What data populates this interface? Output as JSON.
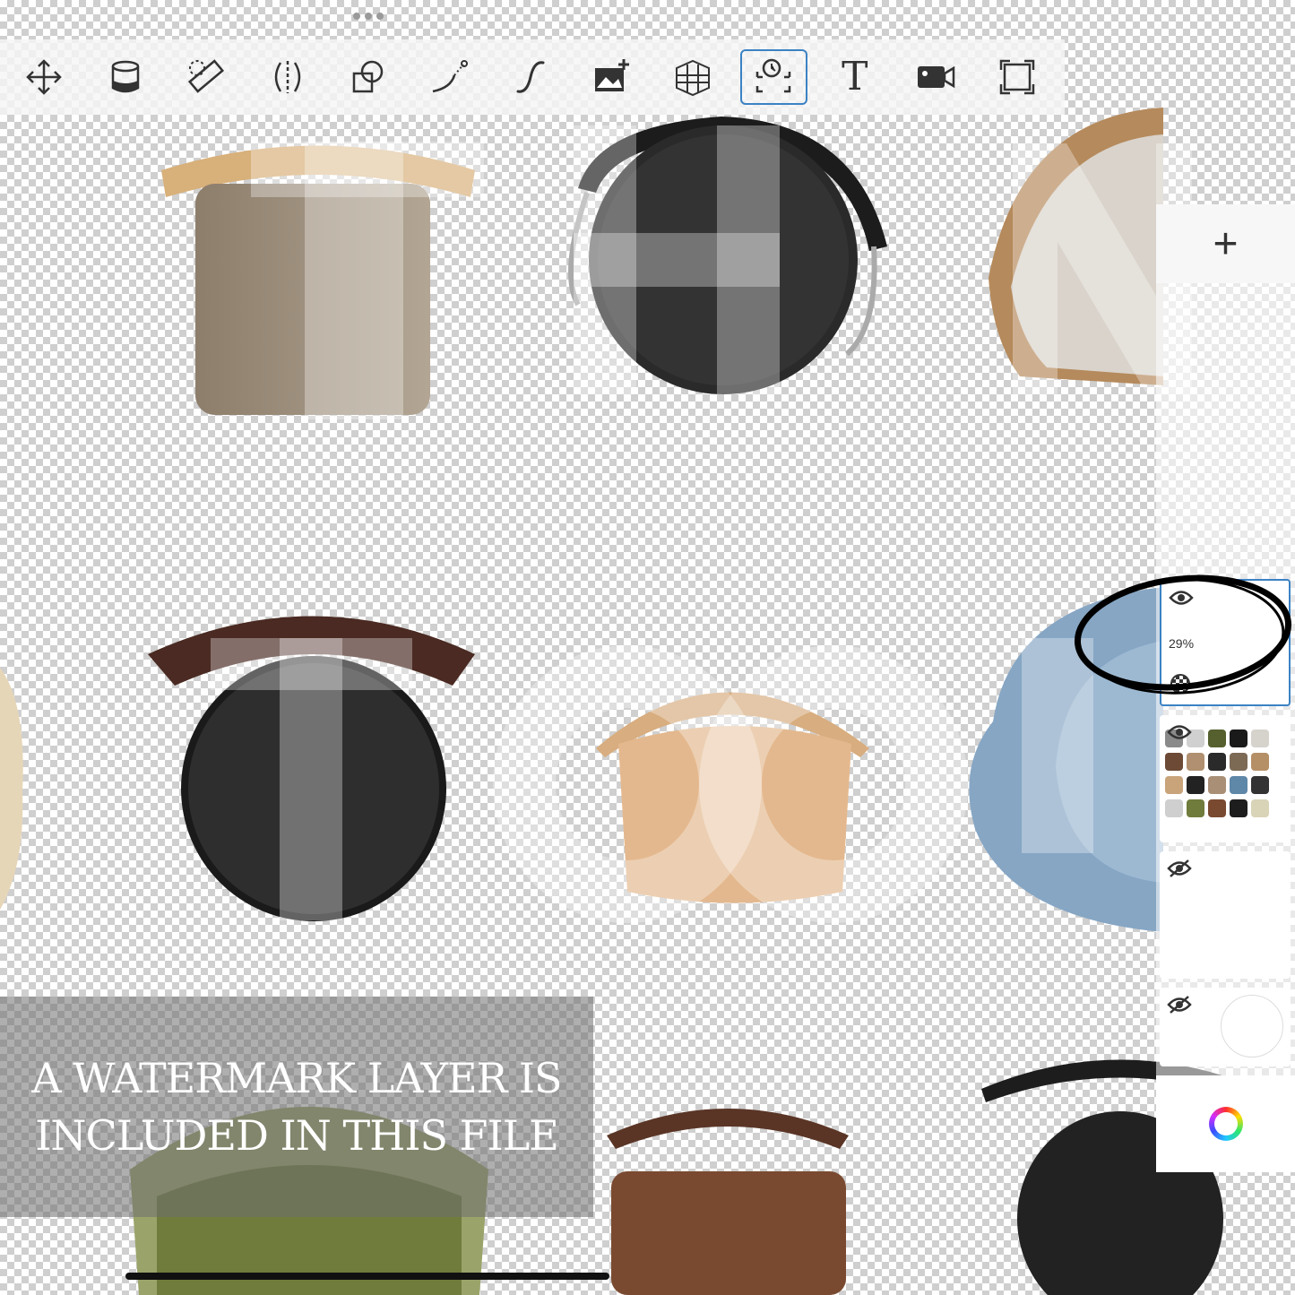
{
  "toolbar": {
    "tools": [
      {
        "name": "move-tool",
        "icon": "move-arrows-icon"
      },
      {
        "name": "fill-tool",
        "icon": "paint-bucket-icon"
      },
      {
        "name": "ruler-tool",
        "icon": "ruler-icon"
      },
      {
        "name": "symmetry-tool",
        "icon": "symmetry-icon"
      },
      {
        "name": "shape-tool",
        "icon": "shapes-icon"
      },
      {
        "name": "curve-tool",
        "icon": "curve-icon"
      },
      {
        "name": "stroke-tool",
        "icon": "stroke-icon"
      },
      {
        "name": "image-insert-tool",
        "icon": "image-add-icon"
      },
      {
        "name": "perspective-tool",
        "icon": "perspective-grid-icon"
      },
      {
        "name": "time-lapse-tool",
        "icon": "time-lapse-icon",
        "active": true
      },
      {
        "name": "text-tool",
        "icon": "text-icon",
        "glyph": "T"
      },
      {
        "name": "record-tool",
        "icon": "video-camera-icon"
      },
      {
        "name": "fullscreen-tool",
        "icon": "fullscreen-icon"
      }
    ]
  },
  "watermark_notice": {
    "line1": "A WATERMARK LAYER IS",
    "line2": "INCLUDED IN THIS FILE"
  },
  "layers": {
    "add_label": "+",
    "selected_layer": {
      "opacity_label": "29%",
      "visible": true
    },
    "layer2": {
      "visible": true
    },
    "layer3": {
      "visible": false
    },
    "layer4": {
      "visible": false
    }
  },
  "colors": {
    "accent": "#3b82c4",
    "toolbar_bg": "#f5f5f5"
  }
}
